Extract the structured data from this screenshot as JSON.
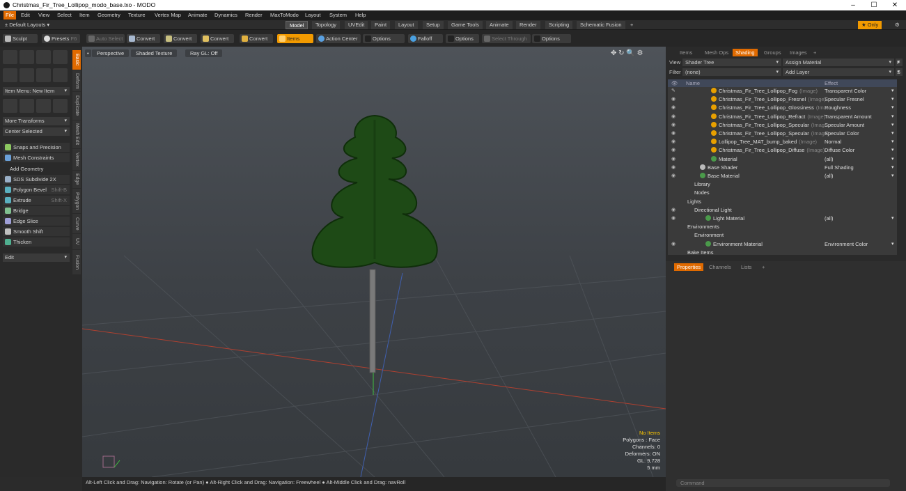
{
  "app": {
    "title": "Christmas_Fir_Tree_Lollipop_modo_base.lxo - MODO",
    "win_min": "–",
    "win_max": "☐",
    "win_close": "✕"
  },
  "menu": [
    "File",
    "Edit",
    "View",
    "Select",
    "Item",
    "Geometry",
    "Texture",
    "Vertex Map",
    "Animate",
    "Dynamics",
    "Render",
    "MaxToModo",
    "Layout",
    "System",
    "Help"
  ],
  "layouts": {
    "label": "Default Layouts ▾",
    "only": "★ Only"
  },
  "tabs": [
    "Model",
    "Topology",
    "UVEdit",
    "Paint",
    "Layout",
    "Setup",
    "Game Tools",
    "Animate",
    "Render",
    "Scripting",
    "Schematic Fusion",
    "+"
  ],
  "toolbar": {
    "sculpt": "Sculpt",
    "presets": "Presets",
    "presets_key": "F6",
    "auto_select": "Auto Select",
    "convert": "Convert",
    "items": "Items",
    "action_center": "Action Center",
    "options": "Options",
    "falloff": "Falloff",
    "select_through": "Select Through"
  },
  "left": {
    "item_menu": "Item Menu: New Item",
    "more_transforms": "More Transforms",
    "center_selected": "Center Selected",
    "snaps": "Snaps and Precision",
    "mesh_constraints": "Mesh Constraints",
    "add_geometry": "Add Geometry",
    "sds": "SDS Subdivide 2X",
    "poly_bevel": "Polygon Bevel",
    "poly_bevel_key": "Shift-B",
    "extrude": "Extrude",
    "extrude_key": "Shift-X",
    "bridge": "Bridge",
    "edge_slice": "Edge Slice",
    "smooth_shift": "Smooth Shift",
    "thicken": "Thicken",
    "edit": "Edit",
    "vtabs": [
      "Basic",
      "Deform",
      "Duplicate",
      "Mesh Edit",
      "Vertex",
      "Edge",
      "Polygon",
      "Curve",
      "UV",
      "Fusion"
    ]
  },
  "viewport": {
    "perspective": "Perspective",
    "shading": "Shaded Texture",
    "raygl": "Ray GL: Off",
    "hud": {
      "items": "No Items",
      "polygons": "Polygons : Face",
      "channels": "Channels: 0",
      "deformers": "Deformers: ON",
      "gl": "GL: 9,728",
      "units": "5 mm"
    }
  },
  "status": "Alt-Left Click and Drag: Navigation: Rotate (or Pan) ● Alt-Right Click and Drag: Navigation: Freewheel ● Alt-Middle Click and Drag: navRoll",
  "right": {
    "tabs": [
      "Items",
      "Mesh Ops",
      "Shading",
      "Groups",
      "Images",
      "+"
    ],
    "view_label": "View",
    "view_value": "Shader Tree",
    "assign": "Assign Material",
    "filter_label": "Filter",
    "filter_value": "(none)",
    "add_layer": "Add Layer",
    "col_name": "Name",
    "col_effect": "Effect",
    "f_key": "F",
    "s_key": "S",
    "rows": [
      {
        "name": "Christmas_Fir_Tree_Lollipop_Fog",
        "tag": "(Image)",
        "effect": "Transparent Color",
        "indent": 40,
        "ball": "#e8a000",
        "eye": "✎"
      },
      {
        "name": "Christmas_Fir_Tree_Lollipop_Fresnel",
        "tag": "(Image)",
        "effect": "Specular Fresnel",
        "indent": 40,
        "ball": "#e8a000",
        "eye": "◉"
      },
      {
        "name": "Christmas_Fir_Tree_Lollipop_Glossiness",
        "tag": "(Im...",
        "effect": "Roughness",
        "indent": 40,
        "ball": "#e8a000",
        "eye": "◉"
      },
      {
        "name": "Christmas_Fir_Tree_Lollipop_Refract",
        "tag": "(Image)",
        "effect": "Transparent Amount",
        "indent": 40,
        "ball": "#e8a000",
        "eye": "◉"
      },
      {
        "name": "Christmas_Fir_Tree_Lollipop_Specular",
        "tag": "(Imag...",
        "effect": "Specular Amount",
        "indent": 40,
        "ball": "#e8a000",
        "eye": "◉"
      },
      {
        "name": "Christmas_Fir_Tree_Lollipop_Specular",
        "tag": "(Image)",
        "effect": "Specular Color",
        "indent": 40,
        "ball": "#e8a000",
        "eye": "◉"
      },
      {
        "name": "Lollipop_Tree_MAT_bump_baked",
        "tag": "(Image)",
        "effect": "Normal",
        "indent": 40,
        "ball": "#e8a000",
        "eye": "◉"
      },
      {
        "name": "Christmas_Fir_Tree_Lollipop_Diffuse",
        "tag": "(Image)",
        "effect": "Diffuse Color",
        "indent": 40,
        "ball": "#e8a000",
        "eye": "◉"
      },
      {
        "name": "Material",
        "tag": "",
        "effect": "(all)",
        "indent": 40,
        "ball": "#4a9a4a",
        "eye": "◉"
      },
      {
        "name": "Base Shader",
        "tag": "",
        "effect": "Full Shading",
        "indent": 24,
        "ball": "#bbbbbb",
        "eye": "◉"
      },
      {
        "name": "Base Material",
        "tag": "",
        "effect": "(all)",
        "indent": 24,
        "ball": "#4a9a4a",
        "eye": "◉"
      },
      {
        "name": "Library",
        "tag": "",
        "effect": "",
        "indent": 16,
        "ball": "",
        "eye": ""
      },
      {
        "name": "Nodes",
        "tag": "",
        "effect": "",
        "indent": 16,
        "ball": "",
        "eye": ""
      },
      {
        "name": "Lights",
        "tag": "",
        "effect": "",
        "indent": 6,
        "ball": "",
        "eye": ""
      },
      {
        "name": "Directional Light",
        "tag": "",
        "effect": "",
        "indent": 16,
        "ball": "",
        "eye": "◉"
      },
      {
        "name": "Light Material",
        "tag": "",
        "effect": "(all)",
        "indent": 32,
        "ball": "#4a9a4a",
        "eye": "◉"
      },
      {
        "name": "Environments",
        "tag": "",
        "effect": "",
        "indent": 6,
        "ball": "",
        "eye": ""
      },
      {
        "name": "Environment",
        "tag": "",
        "effect": "",
        "indent": 16,
        "ball": "",
        "eye": ""
      },
      {
        "name": "Environment Material",
        "tag": "",
        "effect": "Environment Color",
        "indent": 32,
        "ball": "#4a9a4a",
        "eye": "◉"
      },
      {
        "name": "Bake Items",
        "tag": "",
        "effect": "",
        "indent": 6,
        "ball": "",
        "eye": ""
      }
    ],
    "props_tabs": [
      "Properties",
      "Channels",
      "Lists",
      "+"
    ],
    "command": "Command"
  }
}
